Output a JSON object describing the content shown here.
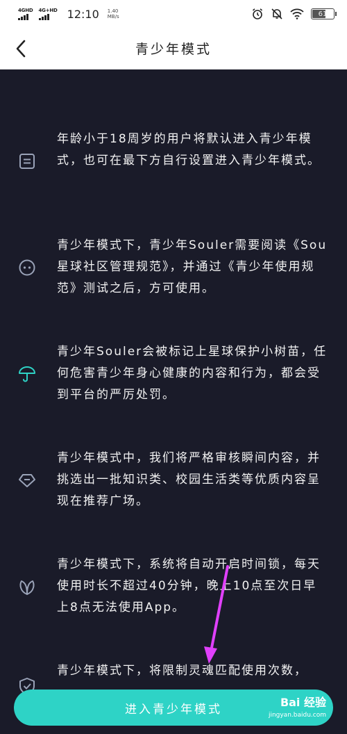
{
  "status_bar": {
    "sim1": "4GHD",
    "sim2": "4G+HD",
    "time": "12:10",
    "speed_value": "1.40",
    "speed_unit": "MB/s",
    "battery": "61"
  },
  "nav": {
    "title": "青少年模式"
  },
  "items": [
    {
      "icon": "document-icon",
      "text": "年龄小于18周岁的用户将默认进入青少年模式，也可在最下方自行设置进入青少年模式。"
    },
    {
      "icon": "smile-face-icon",
      "text": "青少年模式下，青少年Souler需要阅读《Sou星球社区管理规范》，并通过《青少年使用规范》测试之后，方可使用。"
    },
    {
      "icon": "umbrella-icon",
      "text": "青少年Souler会被标记上星球保护小树苗，任何危害青少年身心健康的内容和行为，都会受到平台的严厉处罚。"
    },
    {
      "icon": "diamond-icon",
      "text": "青少年模式中，我们将严格审核瞬间内容，并挑选出一批知识类、校园生活类等优质内容呈现在推荐广场。"
    },
    {
      "icon": "leaf-icon",
      "text": "青少年模式下，系统将自动开启时间锁，每天使用时长不超过40分钟，晚上10点至次日早上8点无法使用App。"
    },
    {
      "icon": "shield-check-icon",
      "text": "青少年模式下，将限制灵魂匹配使用次数，"
    }
  ],
  "enter_button": {
    "label": "进入青少年模式"
  },
  "watermark": {
    "brand": "Bai 经验",
    "url": "jingyan.baidu.com"
  },
  "colors": {
    "accent": "#2ed3c6",
    "background": "#1a1b29",
    "icon": "#9aa3b8",
    "arrow": "#e040fb"
  }
}
